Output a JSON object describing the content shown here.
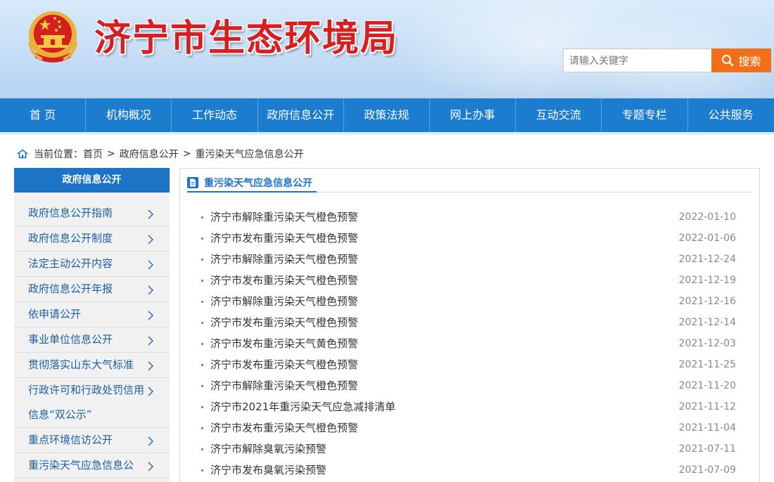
{
  "header": {
    "site_title": "济宁市生态环境局",
    "search_placeholder": "请输入关键字",
    "search_button": "搜索"
  },
  "nav": {
    "items": [
      "首 页",
      "机构概况",
      "工作动态",
      "政府信息公开",
      "政策法规",
      "网上办事",
      "互动交流",
      "专题专栏",
      "公共服务"
    ]
  },
  "breadcrumb": {
    "prefix": "当前位置：",
    "home": "首页",
    "separator": ">",
    "level1": "政府信息公开",
    "level2": "重污染天气应急信息公开"
  },
  "sidebar": {
    "title": "政府信息公开",
    "items": [
      "政府信息公开指南",
      "政府信息公开制度",
      "法定主动公开内容",
      "政府信息公开年报",
      "依申请公开",
      "事业单位信息公开",
      "贯彻落实山东大气标准",
      "行政许可和行政处罚信用信息“双公示”",
      "重点环境信访公开",
      "重污染天气应急信息公"
    ]
  },
  "panel": {
    "title": "重污染天气应急信息公开",
    "news": [
      {
        "title": "济宁市解除重污染天气橙色预警",
        "date": "2022-01-10"
      },
      {
        "title": "济宁市发布重污染天气橙色预警",
        "date": "2022-01-06"
      },
      {
        "title": "济宁市解除重污染天气橙色预警",
        "date": "2021-12-24"
      },
      {
        "title": "济宁市发布重污染天气橙色预警",
        "date": "2021-12-19"
      },
      {
        "title": "济宁市解除重污染天气橙色预警",
        "date": "2021-12-16"
      },
      {
        "title": "济宁市发布重污染天气橙色预警",
        "date": "2021-12-14"
      },
      {
        "title": "济宁市发布重污染天气黄色预警",
        "date": "2021-12-03"
      },
      {
        "title": "济宁市发布重污染天气橙色预警",
        "date": "2021-11-25"
      },
      {
        "title": "济宁市解除重污染天气橙色预警",
        "date": "2021-11-20"
      },
      {
        "title": "济宁市2021年重污染天气应急减排清单",
        "date": "2021-11-12"
      },
      {
        "title": "济宁市发布重污染天气橙色预警",
        "date": "2021-11-04"
      },
      {
        "title": "济宁市解除臭氧污染预警",
        "date": "2021-07-11"
      },
      {
        "title": "济宁市发布臭氧污染预警",
        "date": "2021-07-09"
      }
    ]
  },
  "colors": {
    "brand_red": "#d81e1e",
    "nav_blue": "#1c7ccd",
    "search_orange": "#f26f1a",
    "link_blue": "#1a5fa8"
  }
}
